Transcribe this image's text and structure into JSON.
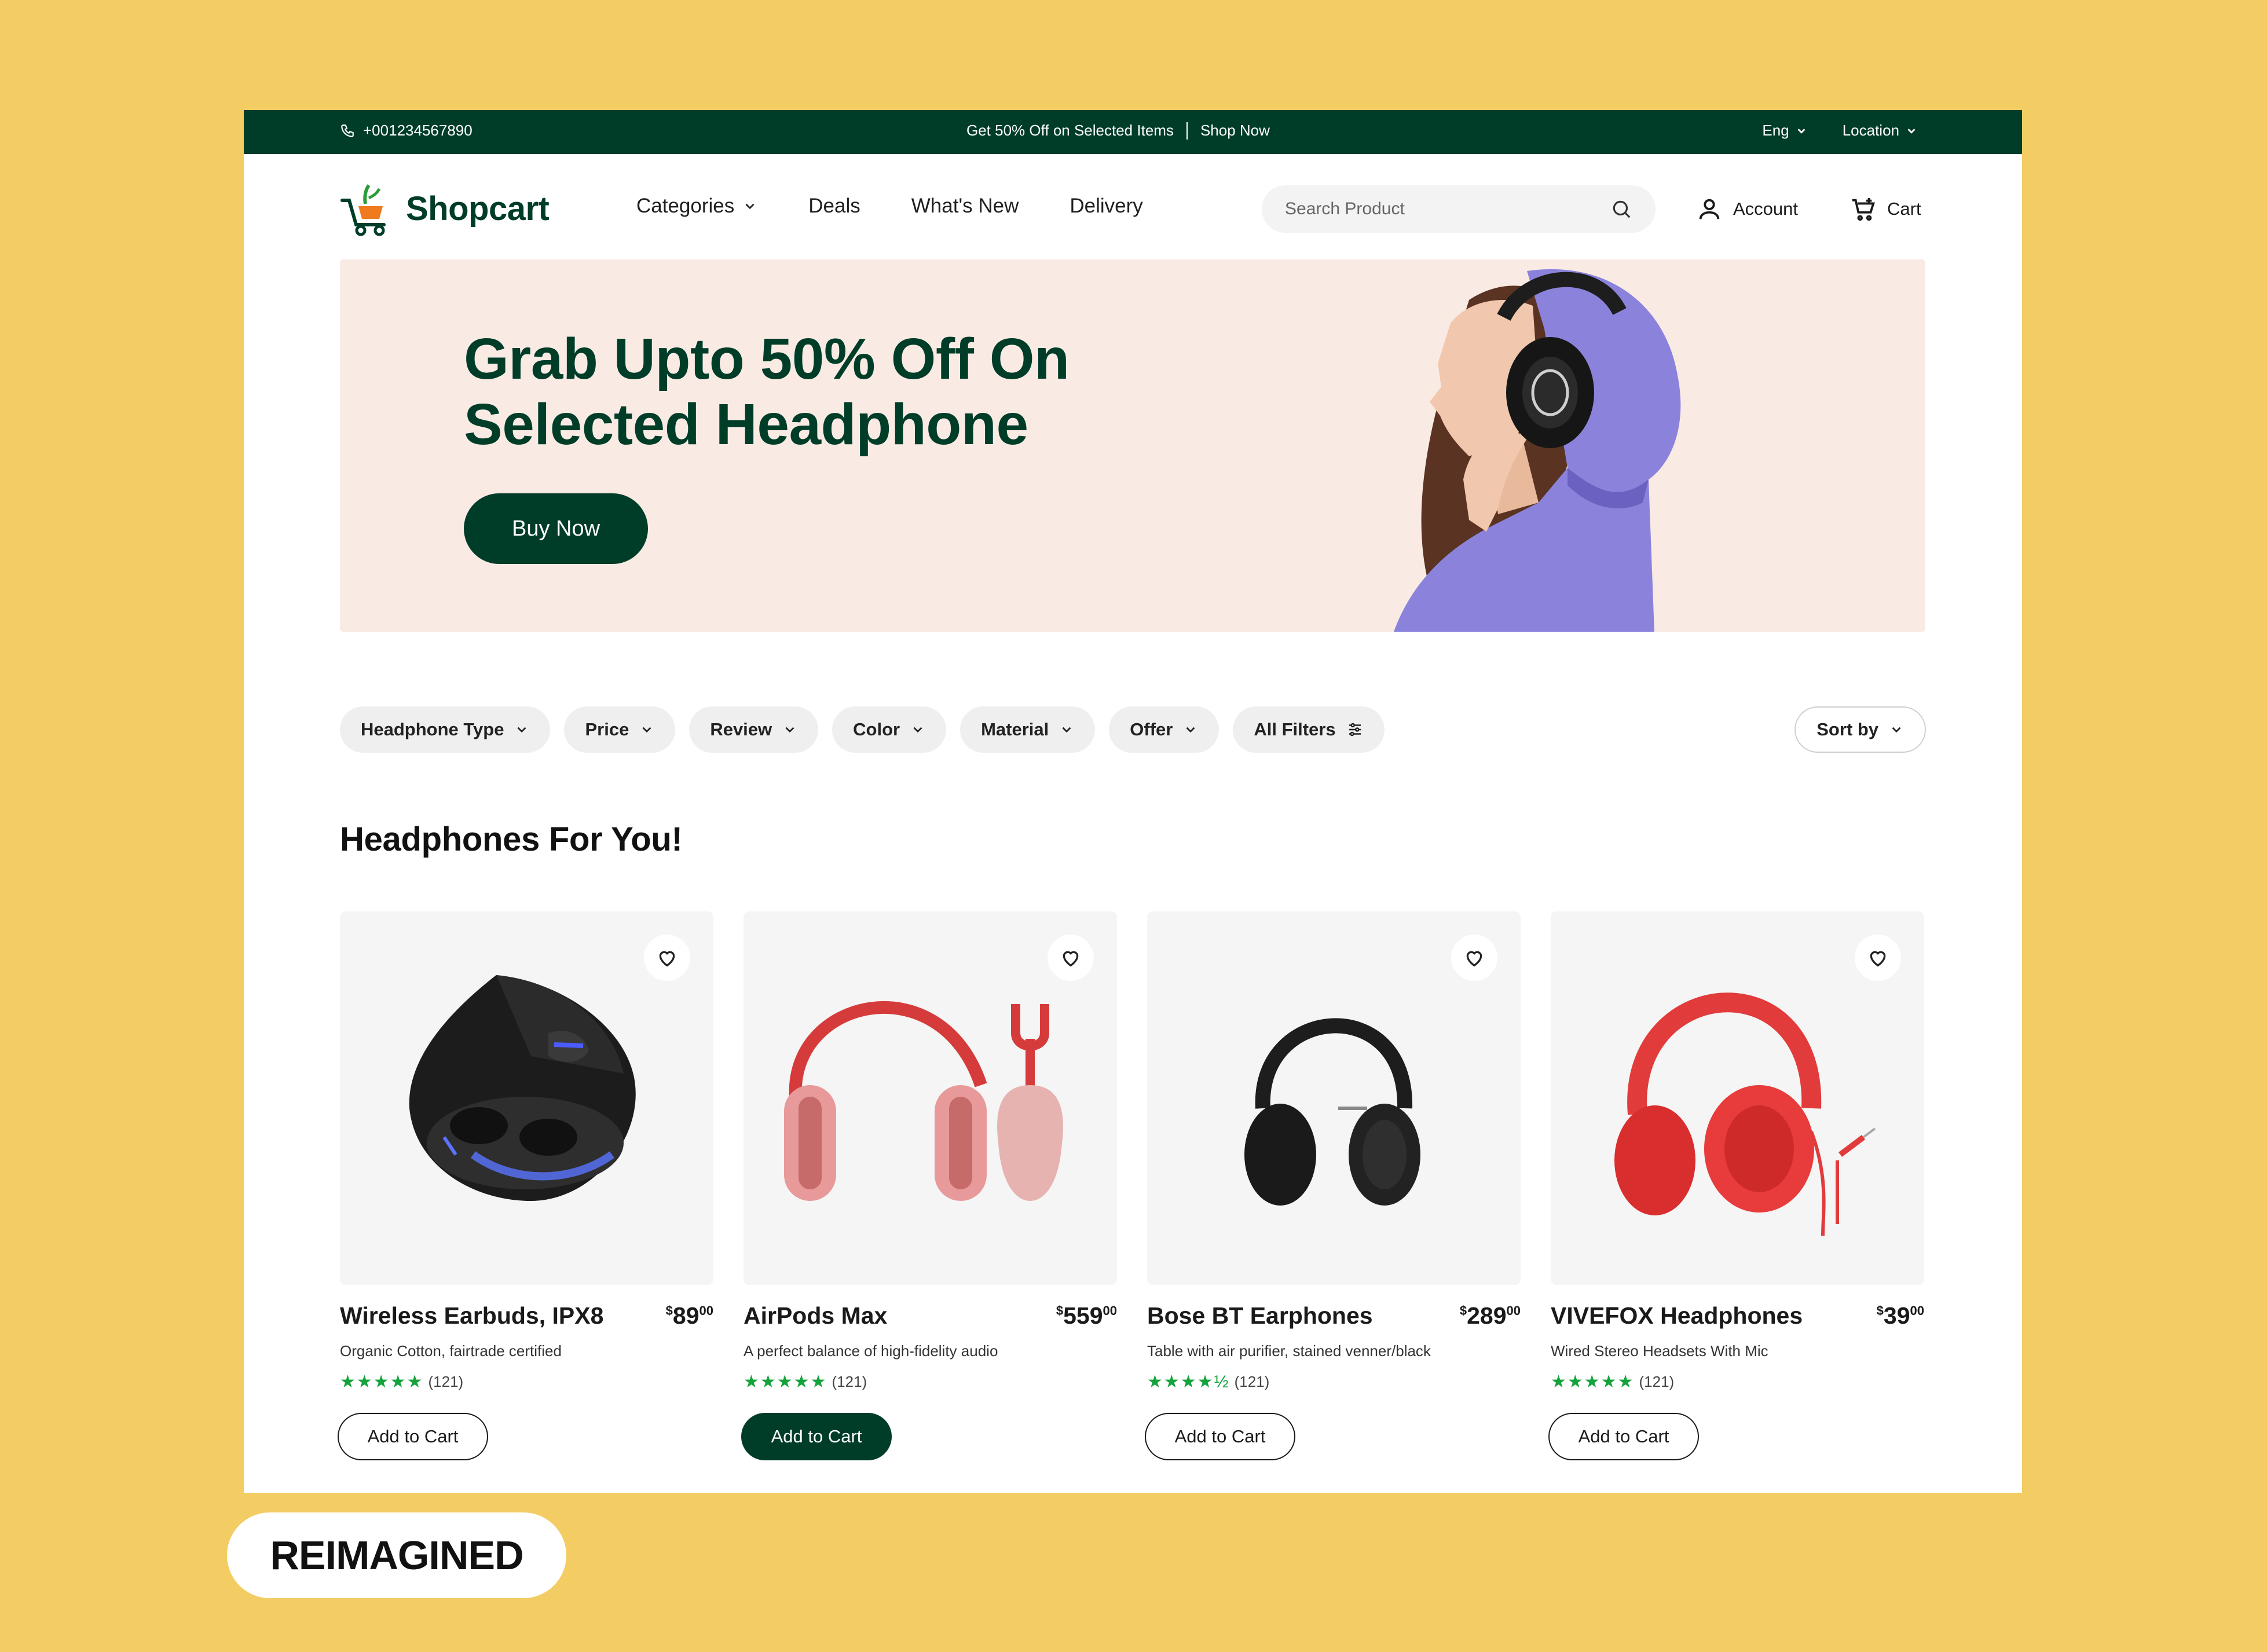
{
  "colors": {
    "brand": "#003d29",
    "star": "#14a33b",
    "background": "#f3cd63",
    "hero_bg": "#f9ebe4"
  },
  "topbar": {
    "phone": "+001234567890",
    "promo": "Get 50% Off on Selected Items",
    "promo_link": "Shop Now",
    "language": "Eng",
    "location": "Location"
  },
  "header": {
    "logo": "Shopcart",
    "nav": [
      "Categories",
      "Deals",
      "What's New",
      "Delivery"
    ],
    "search_placeholder": "Search Product",
    "account": "Account",
    "cart": "Cart"
  },
  "hero": {
    "title_line1": "Grab Upto 50% Off On",
    "title_line2": "Selected Headphone",
    "cta": "Buy Now"
  },
  "filters": [
    "Headphone Type",
    "Price",
    "Review",
    "Color",
    "Material",
    "Offer",
    "All Filters"
  ],
  "sort_label": "Sort by",
  "section_title": "Headphones For You!",
  "products": [
    {
      "name": "Wireless Earbuds, IPX8",
      "currency": "$",
      "price": "89",
      "cents": "00",
      "desc": "Organic Cotton, fairtrade certified",
      "stars": "★★★★★",
      "reviews": "(121)",
      "button": "Add to Cart",
      "rating": 5
    },
    {
      "name": "AirPods Max",
      "currency": "$",
      "price": "559",
      "cents": "00",
      "desc": "A perfect balance of high-fidelity audio",
      "stars": "★★★★★",
      "reviews": "(121)",
      "button": "Add to Cart",
      "rating": 5
    },
    {
      "name": "Bose BT Earphones",
      "currency": "$",
      "price": "289",
      "cents": "00",
      "desc": "Table with air purifier, stained venner/black",
      "stars": "★★★★½",
      "reviews": "(121)",
      "button": "Add to Cart",
      "rating": 4.5
    },
    {
      "name": "VIVEFOX Headphones",
      "currency": "$",
      "price": "39",
      "cents": "00",
      "desc": "Wired Stereo Headsets With Mic",
      "stars": "★★★★★",
      "reviews": "(121)",
      "button": "Add to Cart",
      "rating": 5
    }
  ],
  "badge": "REIMAGINED"
}
